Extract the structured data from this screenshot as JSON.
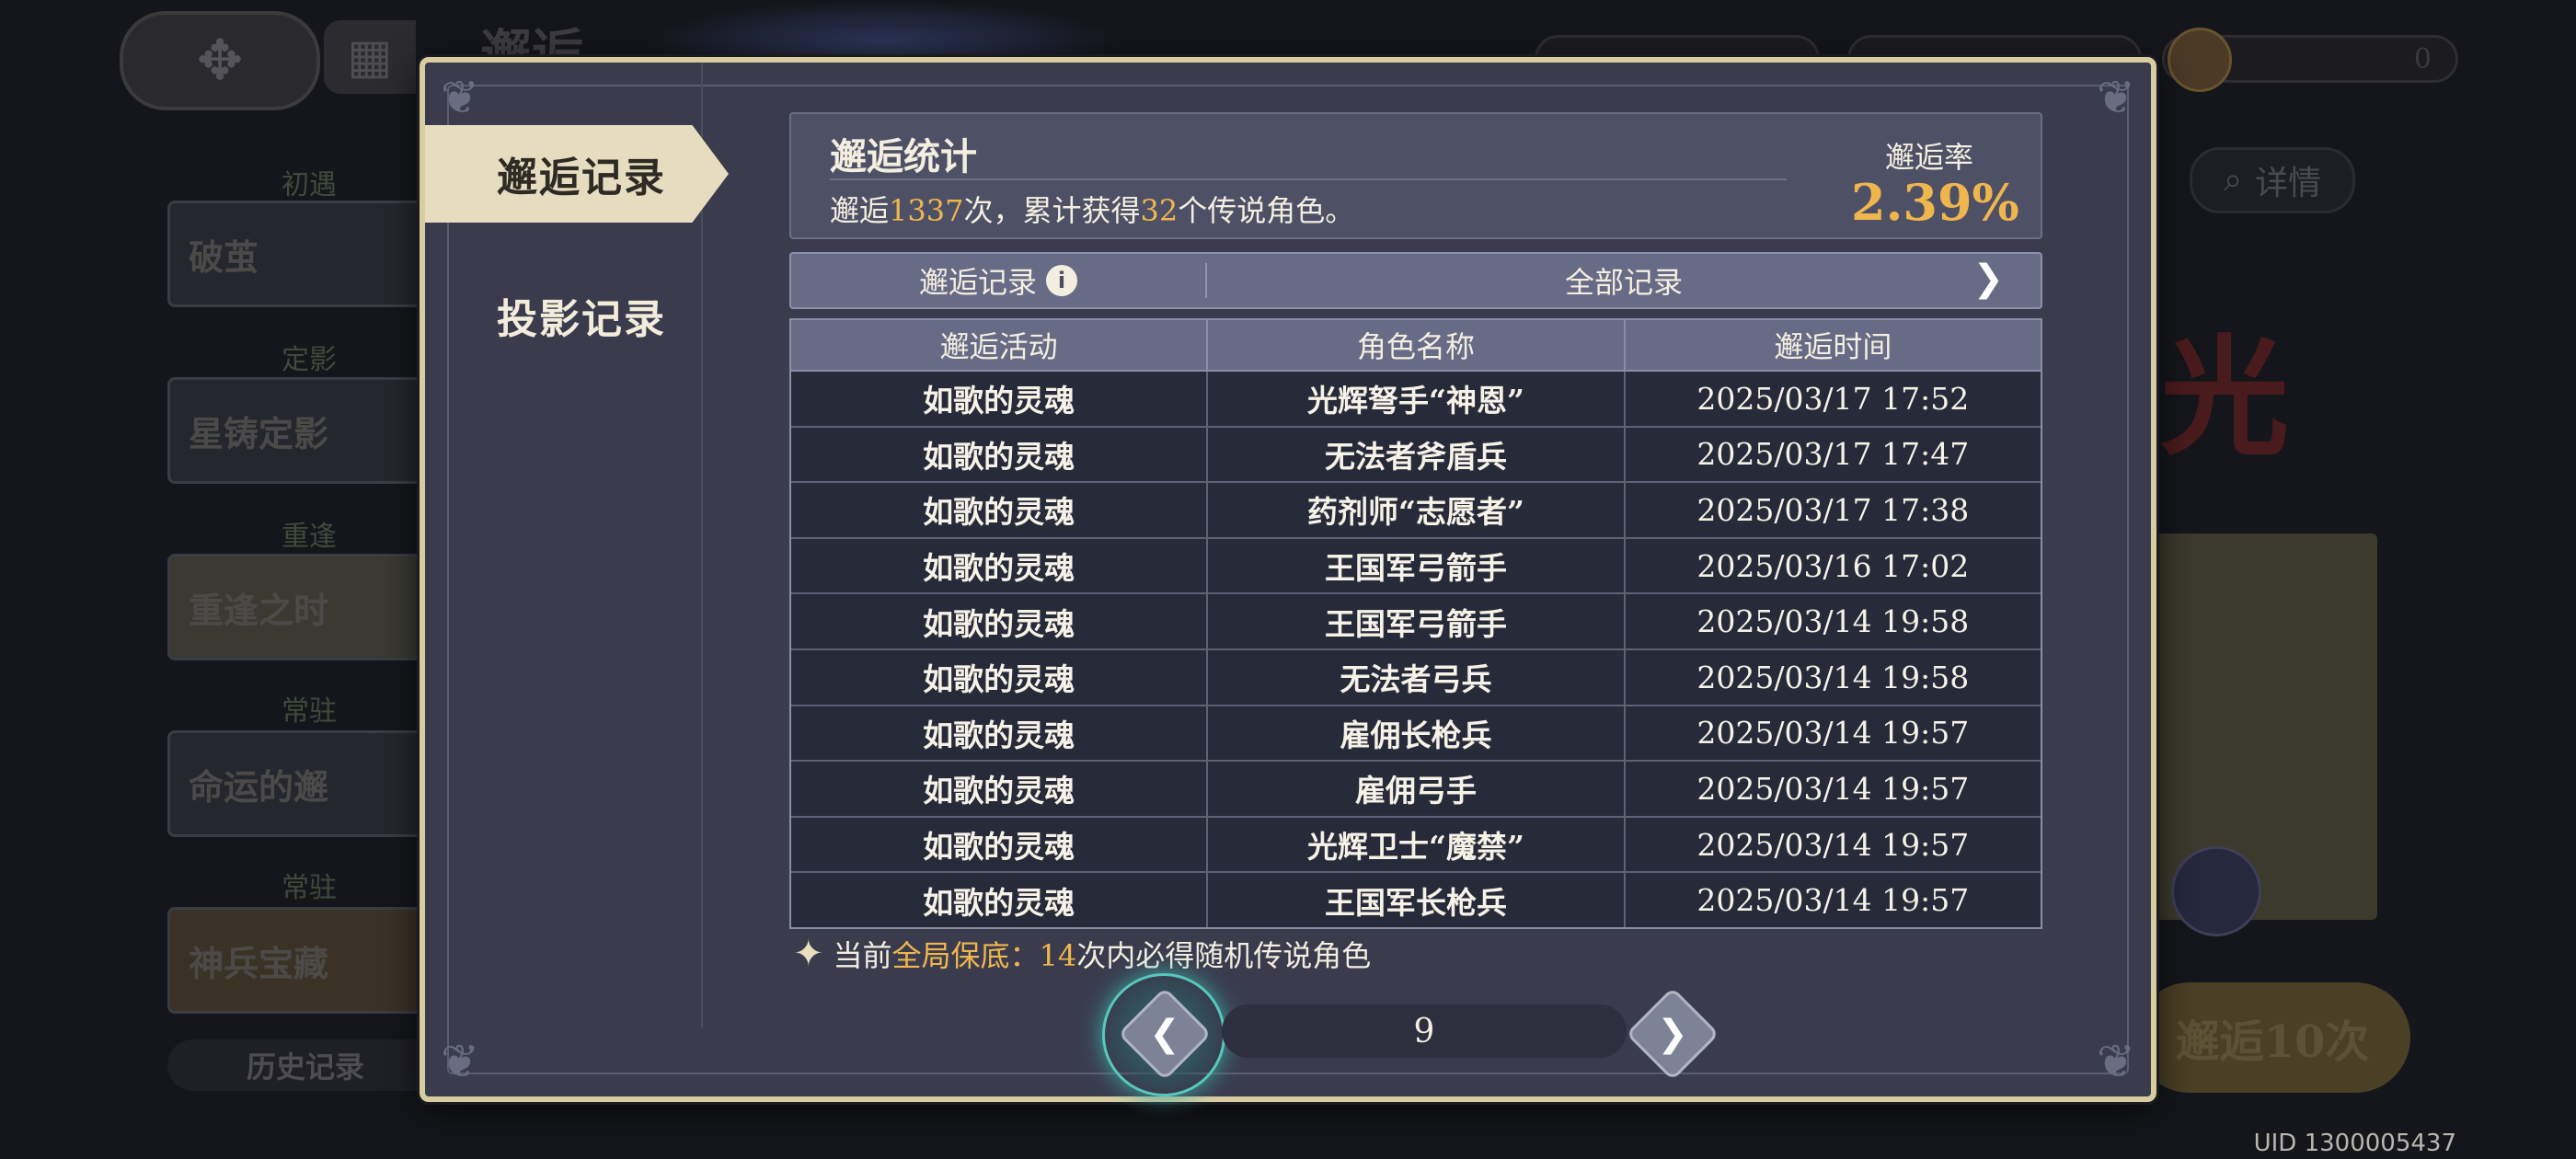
{
  "background": {
    "title": "邂逅",
    "currency_right": "0",
    "sidebar": {
      "sections": [
        {
          "label": "初遇",
          "banner": "破茧"
        },
        {
          "label": "定影",
          "banner": "星铸定影"
        },
        {
          "label": "重逢",
          "banner": "重逢之时"
        },
        {
          "label": "常驻",
          "banner": "命运的邂"
        },
        {
          "label": "常驻",
          "banner": "神兵宝藏"
        }
      ],
      "history_button": "历史记录"
    },
    "details_button": "详情",
    "pull_ten_button": "邂逅10次",
    "red_char": "光",
    "uid": "UID 1300005437"
  },
  "dialog": {
    "tabs": [
      {
        "label": "邂逅记录",
        "active": true
      },
      {
        "label": "投影记录",
        "active": false
      }
    ],
    "stats": {
      "title": "邂逅统计",
      "text_prefix": "邂逅",
      "total_pulls": "1337",
      "text_mid": "次，累计获得",
      "legendary_count": "32",
      "text_suffix": "个传说角色。",
      "rate_label": "邂逅率",
      "rate_value": "2.39%"
    },
    "filter": {
      "label": "邂逅记录",
      "value": "全部记录"
    },
    "table": {
      "headers": [
        "邂逅活动",
        "角色名称",
        "邂逅时间"
      ],
      "rows": [
        [
          "如歌的灵魂",
          "光辉弩手“神恩”",
          "2025/03/17 17:52"
        ],
        [
          "如歌的灵魂",
          "无法者斧盾兵",
          "2025/03/17 17:47"
        ],
        [
          "如歌的灵魂",
          "药剂师“志愿者”",
          "2025/03/17 17:38"
        ],
        [
          "如歌的灵魂",
          "王国军弓箭手",
          "2025/03/16 17:02"
        ],
        [
          "如歌的灵魂",
          "王国军弓箭手",
          "2025/03/14 19:58"
        ],
        [
          "如歌的灵魂",
          "无法者弓兵",
          "2025/03/14 19:58"
        ],
        [
          "如歌的灵魂",
          "雇佣长枪兵",
          "2025/03/14 19:57"
        ],
        [
          "如歌的灵魂",
          "雇佣弓手",
          "2025/03/14 19:57"
        ],
        [
          "如歌的灵魂",
          "光辉卫士“魔禁”",
          "2025/03/14 19:57"
        ],
        [
          "如歌的灵魂",
          "王国军长枪兵",
          "2025/03/14 19:57"
        ]
      ]
    },
    "guarantee": {
      "prefix": "当前",
      "highlight": "全局保底：",
      "count": "14",
      "suffix": "次内必得随机传说角色"
    },
    "pagination": {
      "page": "9"
    }
  },
  "icons": {
    "back": "back-arrow-icon",
    "menu": "menu-icon",
    "info": "info-icon",
    "chevron": "chevron-right-icon",
    "sparkle": "sparkle-icon",
    "prev": "chevron-left-icon",
    "next": "chevron-right-icon"
  }
}
